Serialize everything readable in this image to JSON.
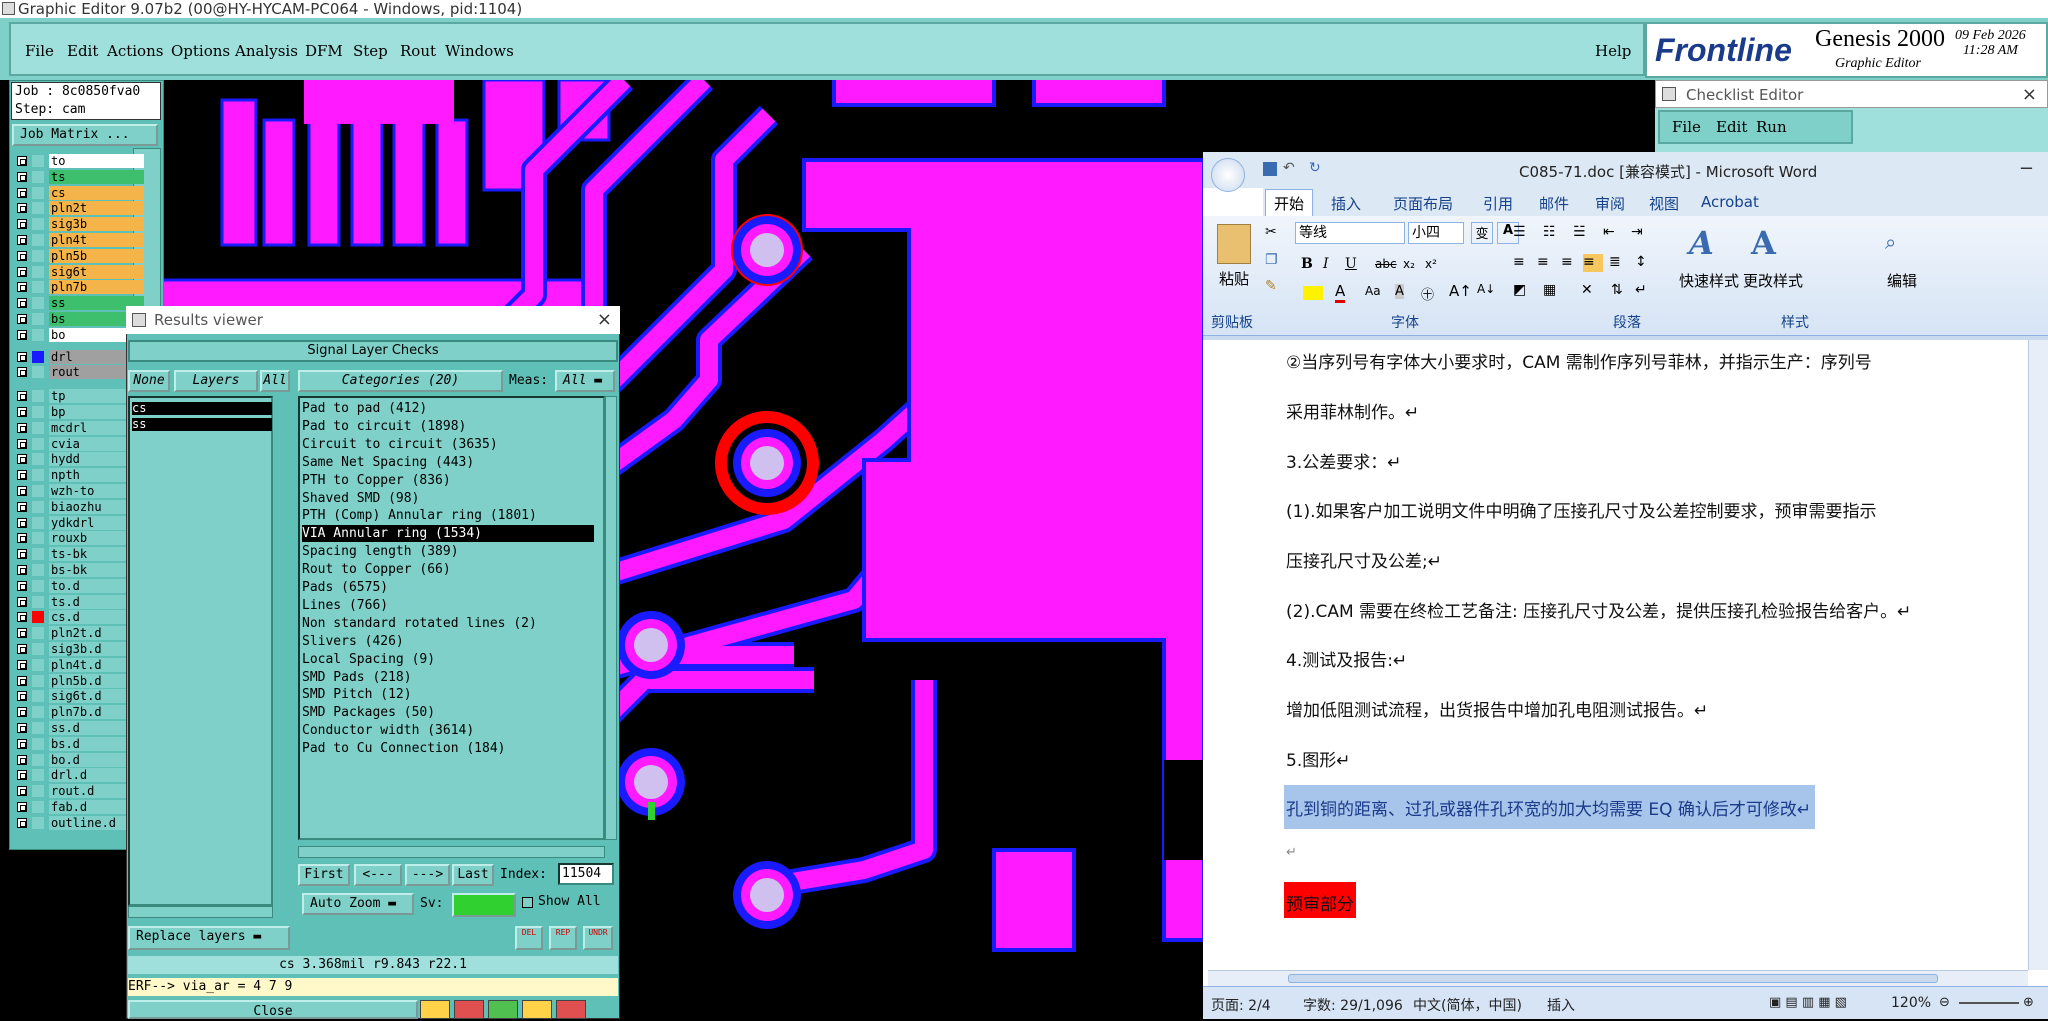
{
  "genesis": {
    "title": "Graphic Editor 9.07b2 (00@HY-HYCAM-PC064 - Windows, pid:1104)",
    "menu": [
      "File",
      "Edit",
      "Actions",
      "Options",
      "Analysis",
      "DFM",
      "Step",
      "Rout",
      "Windows"
    ],
    "help": "Help",
    "brand": {
      "logo": "Frontline",
      "product": "Genesis 2000",
      "subtitle": "Graphic Editor",
      "date": "09 Feb 2026",
      "time": "11:28 AM"
    },
    "job": "Job : 8c0850fva0",
    "step": "Step: cam",
    "job_matrix": "Job Matrix ...",
    "layers": [
      {
        "name": "to",
        "color": "#ffffff"
      },
      {
        "name": "ts",
        "color": "#3dbf6e"
      },
      {
        "name": "cs",
        "color": "#f5b44a"
      },
      {
        "name": "pln2t",
        "color": "#f5b44a"
      },
      {
        "name": "sig3b",
        "color": "#f5b44a"
      },
      {
        "name": "pln4t",
        "color": "#f5b44a"
      },
      {
        "name": "pln5b",
        "color": "#f5b44a"
      },
      {
        "name": "sig6t",
        "color": "#f5b44a"
      },
      {
        "name": "pln7b",
        "color": "#f5b44a"
      },
      {
        "name": "ss",
        "color": "#3dbf6e"
      },
      {
        "name": "bs",
        "color": "#3dbf6e"
      },
      {
        "name": "bo",
        "color": "#ffffff"
      },
      {
        "name": "drl",
        "color": "#a0a0a0"
      },
      {
        "name": "rout",
        "color": "#a0a0a0"
      },
      {
        "name": "tp",
        "color": "#7fd0c8"
      },
      {
        "name": "bp",
        "color": "#7fd0c8"
      },
      {
        "name": "mcdrl",
        "color": "#7fd0c8"
      },
      {
        "name": "cvia",
        "color": "#7fd0c8"
      },
      {
        "name": "hydd",
        "color": "#7fd0c8"
      },
      {
        "name": "npth",
        "color": "#7fd0c8"
      },
      {
        "name": "wzh-to",
        "color": "#7fd0c8"
      },
      {
        "name": "biaozhu",
        "color": "#7fd0c8"
      },
      {
        "name": "ydkdrl",
        "color": "#7fd0c8"
      },
      {
        "name": "rouxb",
        "color": "#7fd0c8"
      },
      {
        "name": "ts-bk",
        "color": "#7fd0c8"
      },
      {
        "name": "bs-bk",
        "color": "#7fd0c8"
      },
      {
        "name": "to.d",
        "color": "#7fd0c8"
      },
      {
        "name": "ts.d",
        "color": "#7fd0c8"
      },
      {
        "name": "cs.d",
        "color": "#7fd0c8"
      },
      {
        "name": "pln2t.d",
        "color": "#7fd0c8"
      },
      {
        "name": "sig3b.d",
        "color": "#7fd0c8"
      },
      {
        "name": "pln4t.d",
        "color": "#7fd0c8"
      },
      {
        "name": "pln5b.d",
        "color": "#7fd0c8"
      },
      {
        "name": "sig6t.d",
        "color": "#7fd0c8"
      },
      {
        "name": "pln7b.d",
        "color": "#7fd0c8"
      },
      {
        "name": "ss.d",
        "color": "#7fd0c8"
      },
      {
        "name": "bs.d",
        "color": "#7fd0c8"
      },
      {
        "name": "bo.d",
        "color": "#7fd0c8"
      },
      {
        "name": "drl.d",
        "color": "#7fd0c8"
      },
      {
        "name": "rout.d",
        "color": "#7fd0c8"
      },
      {
        "name": "fab.d",
        "color": "#7fd0c8"
      },
      {
        "name": "outline.d",
        "color": "#7fd0c8"
      }
    ]
  },
  "results_viewer": {
    "title": "Results viewer",
    "header": "Signal Layer Checks",
    "none": "None",
    "layers_label": "Layers",
    "all": "All",
    "categories_label": "Categories (20)",
    "meas_label": "Meas:",
    "meas_value": "All",
    "layer_items": [
      "cs",
      "ss"
    ],
    "categories": [
      "Pad to pad (412)",
      "Pad to circuit (1898)",
      "Circuit to circuit (3635)",
      "Same Net Spacing (443)",
      "PTH to Copper (836)",
      "Shaved SMD (98)",
      "PTH (Comp) Annular ring (1801)",
      "VIA Annular ring (1534)",
      "Spacing length (389)",
      "Rout to Copper (66)",
      "Pads (6575)",
      "Lines (766)",
      "Non standard rotated lines (2)",
      "Slivers (426)",
      "Local Spacing (9)",
      "SMD Pads (218)",
      "SMD Pitch (12)",
      "SMD Packages (50)",
      "Conductor width (3614)",
      "Pad to Cu Connection (184)"
    ],
    "selected_category": "VIA Annular ring (1534)",
    "nav": {
      "first": "First",
      "prev": "<---",
      "next": "--->",
      "last": "Last",
      "index_label": "Index:",
      "index_value": "11504"
    },
    "auto_zoom": "Auto Zoom",
    "sv_label": "Sv:",
    "show_all": "Show All",
    "replace_layers": "Replace layers",
    "small_buttons": [
      "DEL",
      "REP",
      "UNDR"
    ],
    "readout": "cs 3.368mil  r9.843  r22.1",
    "erf": "ERF--> via_ar = 4 7 9",
    "close": "Close"
  },
  "checklist_editor": {
    "title": "Checklist Editor",
    "menu": [
      "File",
      "Edit",
      "Run"
    ]
  },
  "word": {
    "title": "C085-71.doc [兼容模式] - Microsoft Word",
    "tabs": [
      "开始",
      "插入",
      "页面布局",
      "引用",
      "邮件",
      "审阅",
      "视图",
      "Acrobat"
    ],
    "font_name": "等线",
    "font_size": "小四",
    "groups": [
      "剪贴板",
      "字体",
      "段落",
      "样式"
    ],
    "ribbon_labels": {
      "paste": "粘贴",
      "quick_styles": "快速样式",
      "change_styles": "更改样式",
      "edit": "编辑"
    },
    "paragraphs": [
      "②当序列号有字体大小要求时，CAM 需制作序列号菲林，并指示生产：序列号",
      "采用菲林制作。↵",
      "3.公差要求：↵",
      "(1).如果客户加工说明文件中明确了压接孔尺寸及公差控制要求，预审需要指示",
      "压接孔尺寸及公差;↵",
      "(2).CAM 需要在终检工艺备注: 压接孔尺寸及公差，提供压接孔检验报告给客户。↵",
      "4.测试及报告:↵",
      "增加低阻测试流程，出货报告中增加孔电阻测试报告。↵",
      "5.图形↵"
    ],
    "highlight_para": "孔到铜的距离、过孔或器件孔环宽的加大均需要 EQ 确认后才可修改↵",
    "empty_para": "↵",
    "red_para": "预审部分",
    "status": {
      "page": "页面: 2/4",
      "words": "字数: 29/1,096",
      "lang": "中文(简体，中国)",
      "mode": "插入",
      "zoom": "120%"
    }
  },
  "colors": {
    "teal": "#7fd0c8",
    "magenta": "#ff1aff",
    "blue": "#1a1aff",
    "red": "#ff0000",
    "highlight": "#a7c4ea"
  }
}
